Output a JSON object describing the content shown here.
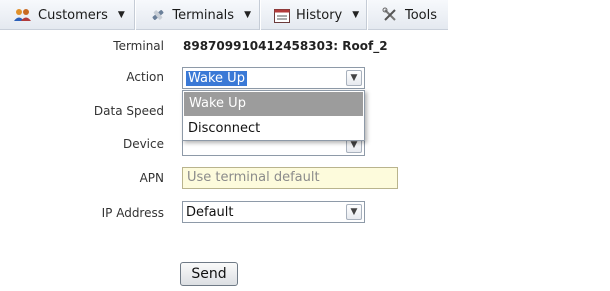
{
  "menu": {
    "items": [
      {
        "label": "Customers",
        "icon": "users-icon",
        "has_caret": true
      },
      {
        "label": "Terminals",
        "icon": "satellite-icon",
        "has_caret": true
      },
      {
        "label": "History",
        "icon": "calendar-icon",
        "has_caret": true
      },
      {
        "label": "Tools",
        "icon": "tools-icon",
        "has_caret": false
      }
    ]
  },
  "form": {
    "terminal": {
      "label": "Terminal",
      "value": "898709910412458303: Roof_2"
    },
    "action": {
      "label": "Action",
      "selected": "Wake Up",
      "options": [
        "Wake Up",
        "Disconnect"
      ],
      "open": true
    },
    "data_speed": {
      "label": "Data Speed"
    },
    "device": {
      "label": "Device",
      "selected": ""
    },
    "apn": {
      "label": "APN",
      "placeholder": "Use terminal default",
      "value": ""
    },
    "ip_address": {
      "label": "IP Address",
      "selected": "Default"
    },
    "send_label": "Send"
  },
  "colors": {
    "highlight": "#3a79d6",
    "apn_background": "#fdfbdc",
    "option_selected_bg": "#9c9c9c"
  }
}
